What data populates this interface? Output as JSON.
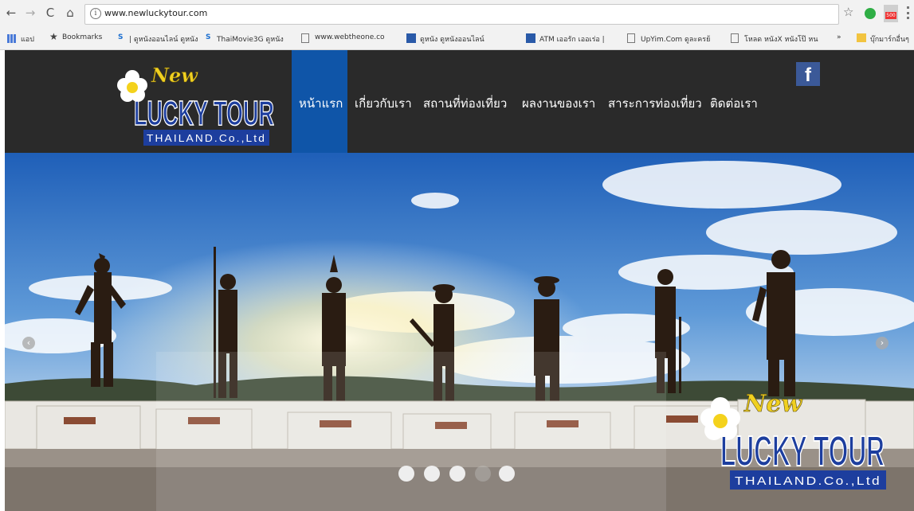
{
  "browser": {
    "url": "www.newluckytour.com",
    "nav_back": "←",
    "nav_forward": "→",
    "nav_reload": "C",
    "nav_home": "⌂",
    "url_info_icon": "i",
    "bookmark_star": "☆",
    "extension_badge": "500",
    "bookmarks": [
      {
        "icon": "apps-icon",
        "label": "แอป"
      },
      {
        "icon": "star-icon",
        "label": "Bookmarks"
      },
      {
        "icon": "s-icon",
        "label": "| ดูหนังออนไลน์ ดูหนัง"
      },
      {
        "icon": "s-icon",
        "label": "ThaiMovie3G ดูหนัง"
      },
      {
        "icon": "page-icon",
        "label": "www.webtheone.co"
      },
      {
        "icon": "film-icon",
        "label": "ดูหนัง ดูหนังออนไลน์"
      },
      {
        "icon": "atm-icon",
        "label": "ATM เออรัก เออเร่อ |"
      },
      {
        "icon": "page-icon",
        "label": "UpYim.Com ดูละครย้"
      },
      {
        "icon": "page-icon",
        "label": "โหลด หนังX หนังโป๊ หน"
      },
      {
        "icon": "more-icon",
        "label": "»"
      },
      {
        "icon": "folder-icon",
        "label": "บุ๊กมาร์กอื่นๆ"
      }
    ]
  },
  "site": {
    "logo": {
      "new": "New",
      "lucky": "LUCKY TOUR",
      "tagline": "THAILAND.Co.,Ltd"
    },
    "nav": [
      "หน้าแรก",
      "เกี่ยวกับเรา",
      "สถานที่ท่องเที่ยว",
      "ผลงานของเรา",
      "สาระการท่องเที่ยว",
      "ติดต่อเรา"
    ],
    "facebook": "f",
    "slider": {
      "prev": "‹",
      "next": "›",
      "dots": 5,
      "active_dot": 4,
      "watermark_logo": {
        "new": "New",
        "lucky": "LUCKY TOUR",
        "tagline": "THAILAND.Co.,Ltd"
      }
    }
  },
  "colors": {
    "header_bg": "#2a2a2a",
    "nav_active": "#0f55a8",
    "facebook": "#3b5998",
    "logo_blue": "#1d3e9e"
  }
}
